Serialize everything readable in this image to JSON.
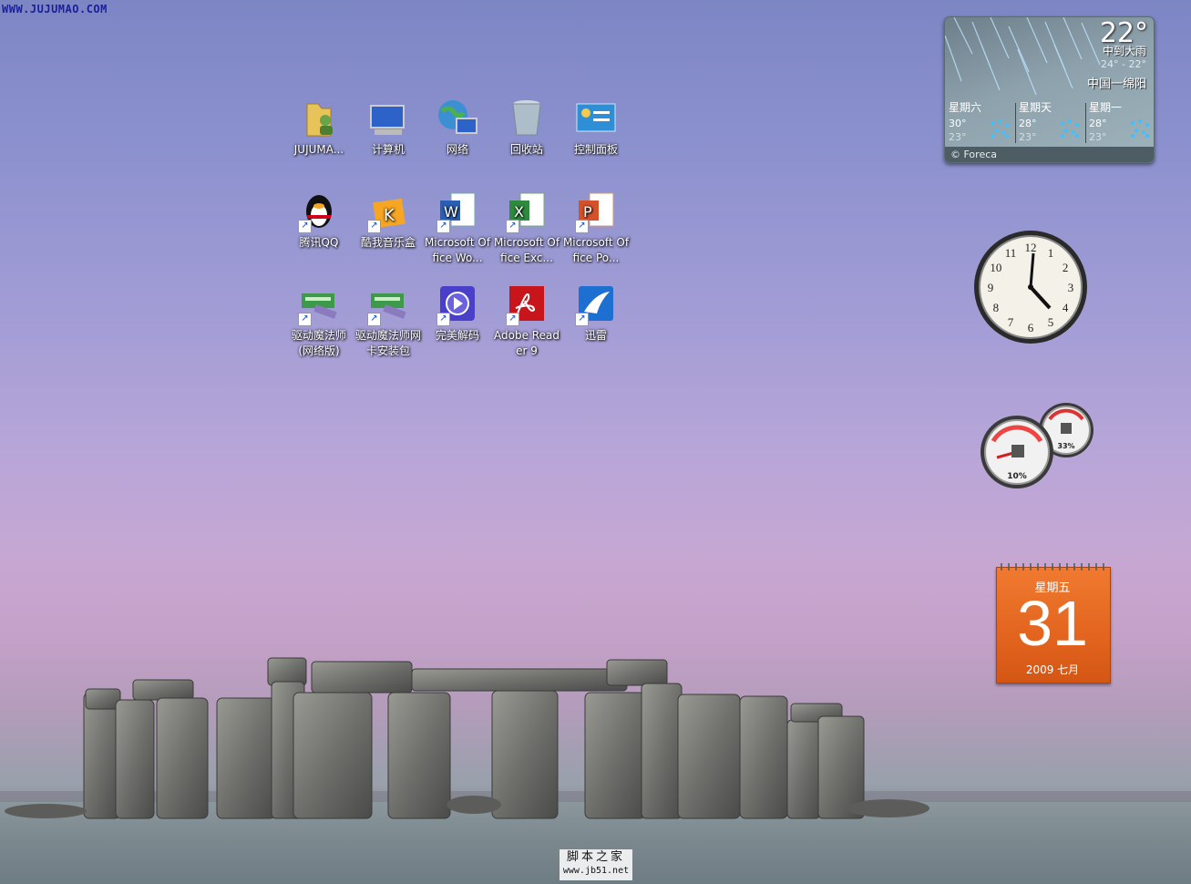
{
  "watermark_top": "WWW.JUJUMAO.COM",
  "desktop_icons": [
    {
      "label": "JUJUMA...",
      "icon": "user-folder-icon",
      "shortcut": false
    },
    {
      "label": "计算机",
      "icon": "computer-icon",
      "shortcut": false
    },
    {
      "label": "网络",
      "icon": "network-icon",
      "shortcut": false
    },
    {
      "label": "回收站",
      "icon": "recycle-bin-icon",
      "shortcut": false
    },
    {
      "label": "控制面板",
      "icon": "control-panel-icon",
      "shortcut": false
    },
    {
      "label": "腾讯QQ",
      "icon": "qq-penguin-icon",
      "shortcut": true
    },
    {
      "label": "酷我音乐盒",
      "icon": "kuwo-music-icon",
      "shortcut": true
    },
    {
      "label": "Microsoft Office Wo...",
      "icon": "word-icon",
      "shortcut": true
    },
    {
      "label": "Microsoft Office Exc...",
      "icon": "excel-icon",
      "shortcut": true
    },
    {
      "label": "Microsoft Office Po...",
      "icon": "powerpoint-icon",
      "shortcut": true
    },
    {
      "label": "驱动魔法师(网络版)",
      "icon": "driver-wizard-icon",
      "shortcut": true
    },
    {
      "label": "驱动魔法师网卡安装包",
      "icon": "driver-wizard-icon",
      "shortcut": true
    },
    {
      "label": "完美解码",
      "icon": "media-player-icon",
      "shortcut": true
    },
    {
      "label": "Adobe Reader 9",
      "icon": "adobe-reader-icon",
      "shortcut": true
    },
    {
      "label": "迅雷",
      "icon": "thunder-icon",
      "shortcut": true
    }
  ],
  "weather": {
    "temp": "22°",
    "condition": "中到大雨",
    "range": "24° - 22°",
    "city": "中国一绵阳",
    "forecast": [
      {
        "day": "星期六",
        "hi": "30°",
        "lo": "23°"
      },
      {
        "day": "星期天",
        "hi": "28°",
        "lo": "23°"
      },
      {
        "day": "星期一",
        "hi": "28°",
        "lo": "23°"
      }
    ],
    "source": "© Foreca"
  },
  "clock": {
    "numbers": [
      "12",
      "1",
      "2",
      "3",
      "4",
      "5",
      "6",
      "7",
      "8",
      "9",
      "10",
      "11"
    ]
  },
  "cpu_meter": {
    "cpu_percent": "10%",
    "memory_percent": "33%"
  },
  "calendar": {
    "weekday": "星期五",
    "day": "31",
    "year_month": "2009 七月"
  },
  "watermark_bottom": {
    "line1": "脚本之家",
    "line2": "www.jb51.net"
  }
}
